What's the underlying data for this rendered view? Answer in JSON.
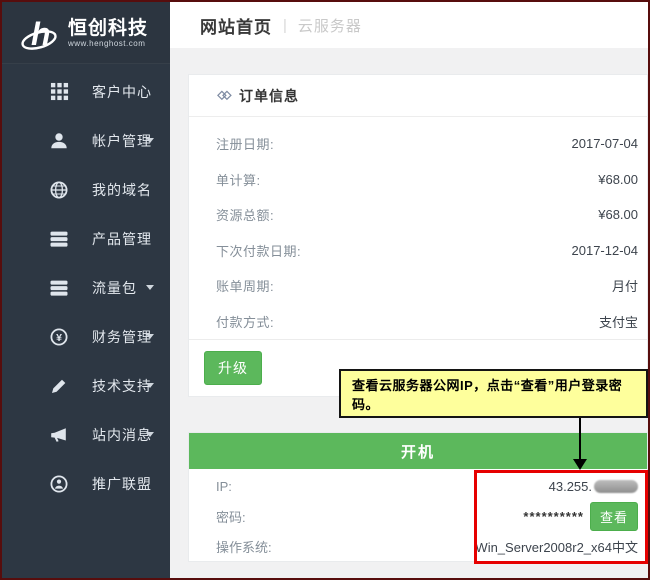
{
  "header": {
    "title": "网站首页",
    "separator": "|",
    "subtitle": "云服务器"
  },
  "sidebar": {
    "logo_title": "恒创科技",
    "logo_subtitle": "www.henghost.com",
    "items": [
      {
        "label": "客户中心",
        "icon": "grid-icon",
        "has_caret": false
      },
      {
        "label": "帐户管理",
        "icon": "user-icon",
        "has_caret": true
      },
      {
        "label": "我的域名",
        "icon": "globe-icon",
        "has_caret": false
      },
      {
        "label": "产品管理",
        "icon": "server-icon",
        "has_caret": false
      },
      {
        "label": "流量包",
        "icon": "server-icon",
        "has_caret": true
      },
      {
        "label": "财务管理",
        "icon": "yen-circle-icon",
        "has_caret": true
      },
      {
        "label": "技术支持",
        "icon": "pencil-icon",
        "has_caret": true
      },
      {
        "label": "站内消息",
        "icon": "megaphone-icon",
        "has_caret": true
      },
      {
        "label": "推广联盟",
        "icon": "person-circle-icon",
        "has_caret": false
      }
    ]
  },
  "order_card": {
    "title": "订单信息",
    "title_icon": "double-diamond-icon",
    "rows": [
      {
        "label": "注册日期:",
        "value": "2017-07-04"
      },
      {
        "label": "单计算:",
        "value": "¥68.00"
      },
      {
        "label": "资源总额:",
        "value": "¥68.00"
      },
      {
        "label": "下次付款日期:",
        "value": "2017-12-04"
      },
      {
        "label": "账单周期:",
        "value": "月付"
      },
      {
        "label": "付款方式:",
        "value": "支付宝"
      }
    ],
    "upgrade_button": "升级"
  },
  "annotation": {
    "text": "查看云服务器公网IP，点击“查看”用户登录密码。"
  },
  "server_card": {
    "power_button": "开机",
    "ip_label": "IP:",
    "ip_value_visible": "43.255.",
    "ip_redacted": "blurred",
    "password_label": "密码:",
    "password_mask": "**********",
    "view_button": "查看",
    "os_label": "操作系统:",
    "os_value": "Win_Server2008r2_x64中文"
  },
  "colors": {
    "sidebar_bg": "#2d3743",
    "accent_green": "#5cb85c",
    "annotation_yellow": "#feff9c",
    "highlight_red": "#e60000",
    "frame_border": "#570d0d"
  }
}
